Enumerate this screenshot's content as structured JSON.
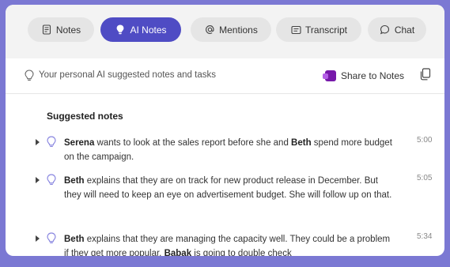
{
  "tabs": [
    {
      "label": "Notes",
      "icon": "notes-icon",
      "active": false
    },
    {
      "label": "AI Notes",
      "icon": "bulb-icon",
      "active": true
    },
    {
      "label": "Mentions",
      "icon": "at-icon",
      "active": false
    },
    {
      "label": "Transcript",
      "icon": "transcript-icon",
      "active": false
    },
    {
      "label": "Chat",
      "icon": "chat-icon",
      "active": false
    }
  ],
  "toolbar": {
    "hint": "Your personal AI suggested notes and tasks",
    "share_label": "Share to Notes"
  },
  "section_title": "Suggested notes",
  "notes": [
    {
      "segments": [
        {
          "text": "Serena",
          "bold": true
        },
        {
          "text": " wants to look at the sales report before she and ",
          "bold": false
        },
        {
          "text": "Beth",
          "bold": true
        },
        {
          "text": " spend more budget on the campaign.",
          "bold": false
        }
      ],
      "time": "5:00"
    },
    {
      "segments": [
        {
          "text": "Beth",
          "bold": true
        },
        {
          "text": " explains that they are on track for new product release in December. But they will need to keep an eye on advertisement budget. She will follow up on that.",
          "bold": false
        }
      ],
      "time": "5:05"
    },
    {
      "segments": [
        {
          "text": "Beth",
          "bold": true
        },
        {
          "text": " explains that they are managing the capacity well. They could be a problem if they get more popular. ",
          "bold": false
        },
        {
          "text": "Babak",
          "bold": true
        },
        {
          "text": " is going to double check",
          "bold": false
        }
      ],
      "time": "5:34"
    }
  ],
  "colors": {
    "background": "#7b78d3",
    "active_tab": "#4f4cc4",
    "onenote": "#7719aa"
  }
}
